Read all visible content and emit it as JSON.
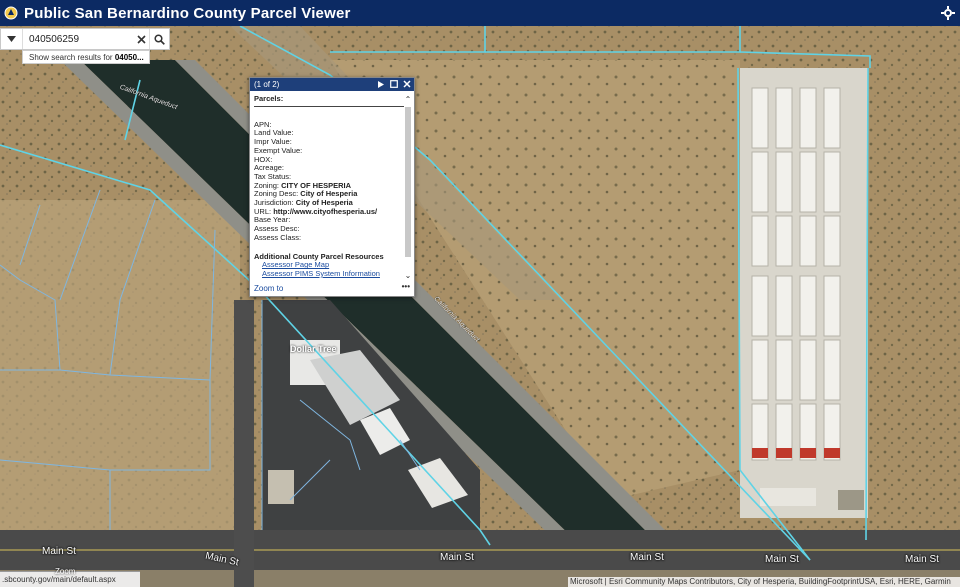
{
  "header": {
    "title": "Public San Bernardino County Parcel Viewer",
    "accent": "#0c2a63"
  },
  "search": {
    "value": "040506259",
    "suggestion_prefix": "Show search results for ",
    "suggestion_bold": "04050..."
  },
  "map": {
    "labels": {
      "aqueduct_top": "California Aqueduct",
      "aqueduct_mid": "California Aqueduct",
      "store": "Dollar Tree",
      "main_st_1": "Main St",
      "main_st_2": "Main St",
      "main_st_3": "Main St",
      "main_st_4": "Main St",
      "main_st_5": "Main St",
      "main_st_6": "Main St"
    },
    "parcel_line_color": "#5fd3e6",
    "status_url": ".sbcounty.gov/main/default.aspx",
    "zoom_label": "Zoom",
    "attribution": "Microsoft | Esri Community Maps Contributors, City of Hesperia, BuildingFootprintUSA, Esri, HERE, Garmin"
  },
  "popup": {
    "counter": "(1 of 2)",
    "section_title": "Parcels:",
    "fields": [
      {
        "label": "APN:",
        "value": ""
      },
      {
        "label": "Land Value:",
        "value": ""
      },
      {
        "label": "Impr Value:",
        "value": ""
      },
      {
        "label": "Exempt Value:",
        "value": ""
      },
      {
        "label": "HOX:",
        "value": ""
      },
      {
        "label": "Acreage:",
        "value": ""
      },
      {
        "label": "Tax Status:",
        "value": ""
      },
      {
        "label": "Zoning:",
        "value": "CITY OF HESPERIA"
      },
      {
        "label": "Zoning Desc:",
        "value": "City of Hesperia"
      },
      {
        "label": "Jurisdiction:",
        "value": "City of Hesperia"
      },
      {
        "label": "URL:",
        "value": "http://www.cityofhesperia.us/"
      },
      {
        "label": "Base Year:",
        "value": ""
      },
      {
        "label": "Assess Desc:",
        "value": ""
      },
      {
        "label": "Assess Class:",
        "value": ""
      }
    ],
    "resources_title": "Additional County Parcel Resources",
    "links": [
      "Assessor Page Map",
      "Assessor PIMS System Information"
    ],
    "zoom_to": "Zoom to",
    "more": "•••"
  }
}
